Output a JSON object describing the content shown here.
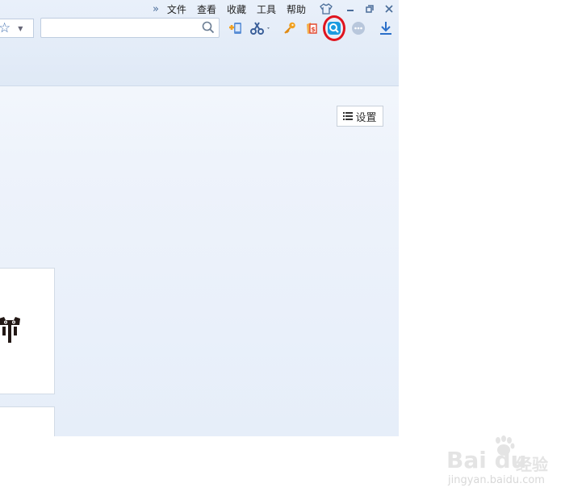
{
  "menubar": {
    "more": "»",
    "items": [
      "文件",
      "查看",
      "收藏",
      "工具",
      "帮助"
    ]
  },
  "search": {
    "value": "",
    "placeholder": ""
  },
  "toolbar": {
    "tools": [
      "add-to-desktop-icon",
      "screenshot-scissors-icon",
      "key-icon",
      "red-packet-icon",
      "search-magnifier-app-icon",
      "more-options-icon",
      "download-icon"
    ],
    "highlighted_tool": "search-magnifier-app-icon"
  },
  "content": {
    "settings_label": "设置"
  },
  "watermark": {
    "logo": "Bai du",
    "cn": "经验",
    "url": "jingyan.baidu.com"
  },
  "colors": {
    "accent": "#3d6cad",
    "highlight_ring": "#e0141e"
  }
}
